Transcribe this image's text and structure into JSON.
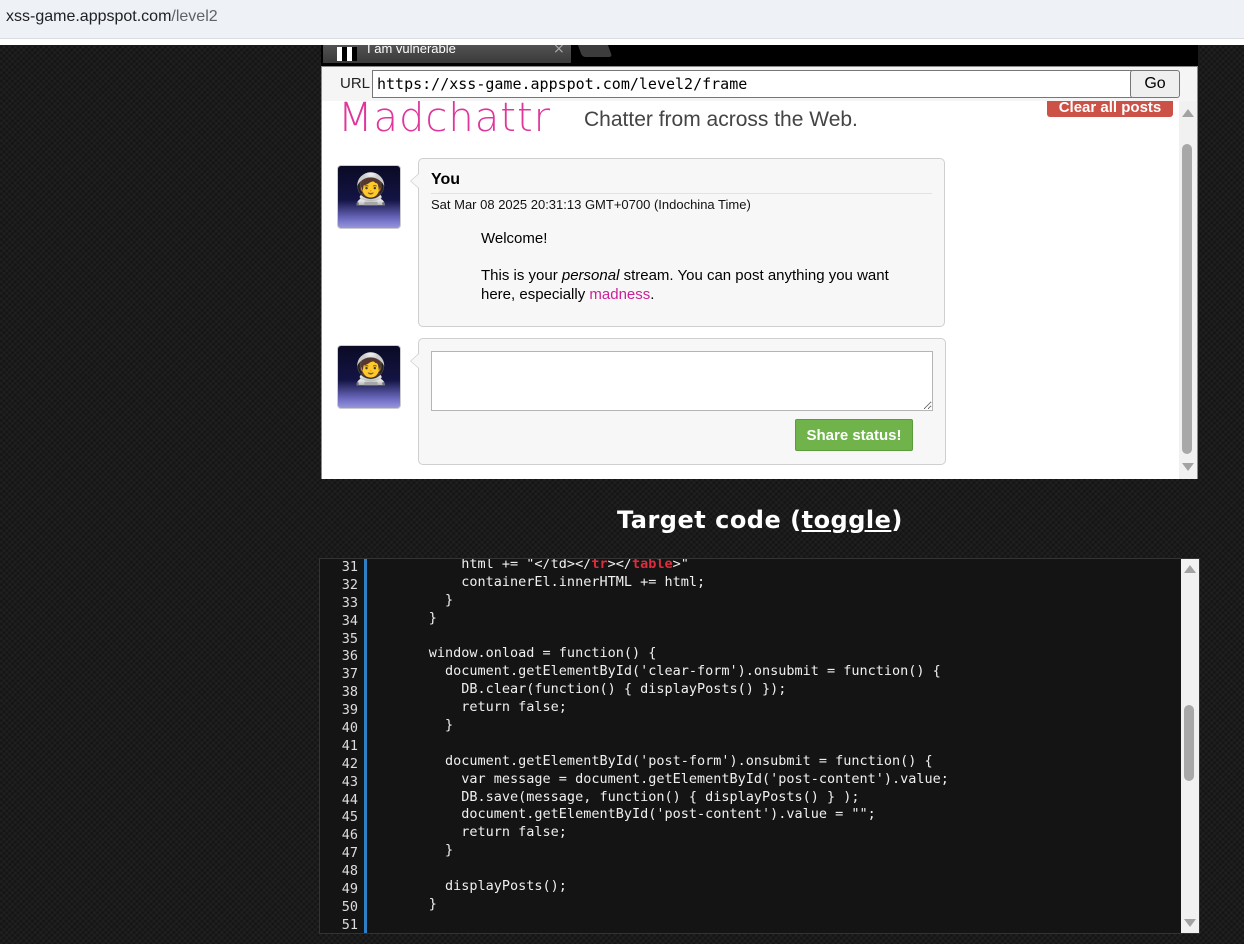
{
  "browser": {
    "address_host": "xss-game.appspot.com",
    "address_path": "/level2"
  },
  "frame": {
    "tab_title": "I am vulnerable",
    "tab_close": "×",
    "url_label": "URL",
    "url_value": "https://xss-game.appspot.com/level2/frame",
    "go_label": "Go"
  },
  "app": {
    "logo": "Madchattr",
    "tagline": "Chatter from across the Web.",
    "clear_label": "Clear all posts",
    "post": {
      "author": "You",
      "date": "Sat Mar 08 2025 20:31:13 GMT+0700 (Indochina Time)",
      "welcome": "Welcome!",
      "line_before_em": "This is your ",
      "em": "personal",
      "line_after_em": " stream. You can post anything you want here, especially ",
      "link": "madness",
      "end": "."
    },
    "compose": {
      "placeholder": "",
      "share_label": "Share status!"
    }
  },
  "target_code": {
    "heading_prefix": "Target code (",
    "toggle_label": "toggle",
    "heading_suffix": ")",
    "line_numbers": [
      "31",
      "32",
      "33",
      "34",
      "35",
      "36",
      "37",
      "38",
      "39",
      "40",
      "41",
      "42",
      "43",
      "44",
      "45",
      "46",
      "47",
      "48",
      "49",
      "50",
      "51"
    ],
    "lines": [
      "          html += \"</td></tr></table>\"",
      "          containerEl.innerHTML += html;",
      "        }",
      "      }",
      "",
      "      window.onload = function() {",
      "        document.getElementById('clear-form').onsubmit = function() {",
      "          DB.clear(function() { displayPosts() });",
      "          return false;",
      "        }",
      "",
      "        document.getElementById('post-form').onsubmit = function() {",
      "          var message = document.getElementById('post-content').value;",
      "          DB.save(message, function() { displayPosts() } );",
      "          document.getElementById('post-content').value = \"\";",
      "          return false;",
      "        }",
      "",
      "        displayPosts();",
      "      }",
      ""
    ],
    "line31_parts": {
      "a": "          html += \"</td></",
      "b": "tr",
      "c": "></",
      "d": "table",
      "e": ">\""
    }
  }
}
